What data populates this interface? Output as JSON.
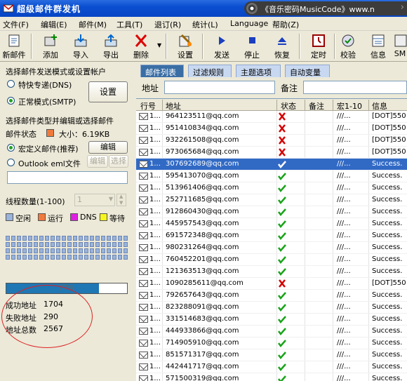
{
  "window": {
    "title": "超级邮件群发机",
    "music_text": "《音乐密码MusicCode》www.n"
  },
  "menu": [
    "文件(F)",
    "编辑(E)",
    "邮件(M)",
    "工具(T)",
    "退订(R)",
    "统计(L)",
    "Language",
    "帮助(Z)"
  ],
  "toolbar": [
    {
      "label": "新邮件",
      "icon": "new-mail-icon"
    },
    {
      "label": "添加",
      "icon": "add-icon"
    },
    {
      "label": "导入",
      "icon": "import-icon"
    },
    {
      "label": "导出",
      "icon": "export-icon"
    },
    {
      "label": "删除",
      "icon": "delete-icon"
    },
    {
      "label": "设置",
      "icon": "settings-icon"
    },
    {
      "label": "发送",
      "icon": "send-icon"
    },
    {
      "label": "停止",
      "icon": "stop-icon"
    },
    {
      "label": "恢复",
      "icon": "resume-icon"
    },
    {
      "label": "定时",
      "icon": "timer-icon"
    },
    {
      "label": "校验",
      "icon": "verify-icon"
    },
    {
      "label": "信息",
      "icon": "info-icon"
    },
    {
      "label": "SM",
      "icon": "sms-icon"
    }
  ],
  "left": {
    "mode_heading": "选择邮件发送模式或设置帐户",
    "mode_dns": "特快专递(DNS)",
    "mode_smtp": "正常模式(SMTP)",
    "settings_button": "设置",
    "type_heading": "选择邮件类型并编辑或选择邮件",
    "mail_status_label": "邮件状态",
    "mail_size": "大小：6.19KB",
    "type_macro": "宏定义邮件(推荐)",
    "edit_button": "编辑",
    "type_outlook": "Outlook eml文件",
    "edit_button2": "编辑",
    "choose_button": "选择",
    "thread_label": "线程数量(1-100)",
    "thread_value": "1",
    "legend": [
      {
        "label": "空闲",
        "color": "#9ab4da"
      },
      {
        "label": "运行",
        "color": "#f07a3c"
      },
      {
        "label": "DNS",
        "color": "#e020e0"
      },
      {
        "label": "等待",
        "color": "#f6f61c"
      }
    ],
    "progress": {
      "percent": 77,
      "text": "77%"
    },
    "stats": {
      "success_label": "成功地址",
      "success_value": "1704",
      "fail_label": "失败地址",
      "fail_value": "290",
      "total_label": "地址总数",
      "total_value": "2567"
    }
  },
  "right": {
    "tabs": [
      "邮件列表",
      "过滤规则",
      "主题选项",
      "自动变量"
    ],
    "address_label": "地址",
    "note_label": "备注",
    "columns": [
      "行号",
      "地址",
      "状态",
      "备注",
      "宏1-10",
      "信息"
    ],
    "rows": [
      {
        "no": "1...",
        "address": "964123511@qq.com",
        "status": "fail",
        "macro": "///...",
        "info": "[DOT]550"
      },
      {
        "no": "1...",
        "address": "951410834@qq.com",
        "status": "fail",
        "macro": "///...",
        "info": "[DOT]550"
      },
      {
        "no": "1...",
        "address": "932261508@qq.com",
        "status": "fail",
        "macro": "///...",
        "info": "[DOT]550"
      },
      {
        "no": "1...",
        "address": "973065684@qq.com",
        "status": "fail",
        "macro": "///...",
        "info": "[DOT]550"
      },
      {
        "no": "1...",
        "address": "307692689@qq.com",
        "status": "ok",
        "macro": "///...",
        "info": "Success.",
        "selected": true
      },
      {
        "no": "1...",
        "address": "595413070@qq.com",
        "status": "ok",
        "macro": "///...",
        "info": "Success."
      },
      {
        "no": "1...",
        "address": "513961406@qq.com",
        "status": "ok",
        "macro": "///...",
        "info": "Success."
      },
      {
        "no": "1...",
        "address": "252711685@qq.com",
        "status": "ok",
        "macro": "///...",
        "info": "Success."
      },
      {
        "no": "1...",
        "address": "912860430@qq.com",
        "status": "ok",
        "macro": "///...",
        "info": "Success."
      },
      {
        "no": "1...",
        "address": "445957543@qq.com",
        "status": "ok",
        "macro": "///...",
        "info": "Success."
      },
      {
        "no": "1...",
        "address": "691572348@qq.com",
        "status": "ok",
        "macro": "///...",
        "info": "Success."
      },
      {
        "no": "1...",
        "address": "980231264@qq.com",
        "status": "ok",
        "macro": "///...",
        "info": "Success."
      },
      {
        "no": "1...",
        "address": "760452201@qq.com",
        "status": "ok",
        "macro": "///...",
        "info": "Success."
      },
      {
        "no": "1...",
        "address": "121363513@qq.com",
        "status": "ok",
        "macro": "///...",
        "info": "Success."
      },
      {
        "no": "1...",
        "address": "1090285611@qq.com",
        "status": "fail",
        "macro": "///...",
        "info": "[DOT]550"
      },
      {
        "no": "1...",
        "address": "792657643@qq.com",
        "status": "ok",
        "macro": "///...",
        "info": "Success."
      },
      {
        "no": "1...",
        "address": "823288091@qq.com",
        "status": "ok",
        "macro": "///...",
        "info": "Success."
      },
      {
        "no": "1...",
        "address": "331514683@qq.com",
        "status": "ok",
        "macro": "///...",
        "info": "Success."
      },
      {
        "no": "1...",
        "address": "444933866@qq.com",
        "status": "ok",
        "macro": "///...",
        "info": "Success."
      },
      {
        "no": "1...",
        "address": "714905910@qq.com",
        "status": "ok",
        "macro": "///...",
        "info": "Success."
      },
      {
        "no": "1...",
        "address": "851571317@qq.com",
        "status": "ok",
        "macro": "///...",
        "info": "Success."
      },
      {
        "no": "1...",
        "address": "442441717@qq.com",
        "status": "ok",
        "macro": "///...",
        "info": "Success."
      },
      {
        "no": "1...",
        "address": "571500319@qq.com",
        "status": "ok",
        "macro": "///...",
        "info": "Success."
      }
    ]
  }
}
